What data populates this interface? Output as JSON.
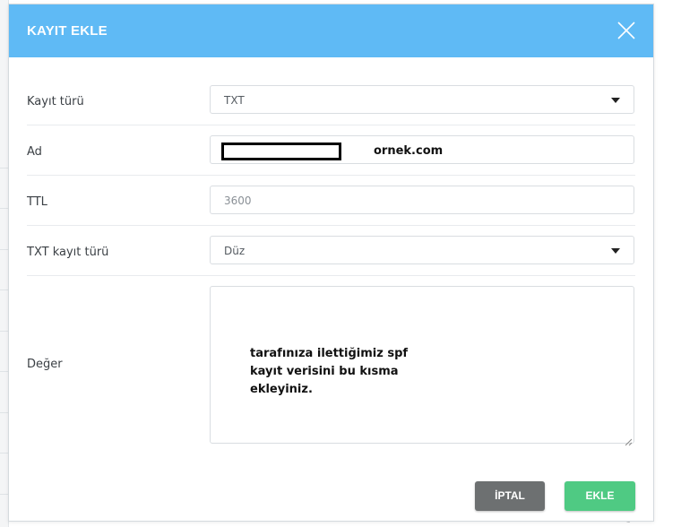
{
  "modal": {
    "title": "KAYIT EKLE",
    "close_icon": "close-icon"
  },
  "form": {
    "record_type": {
      "label": "Kayıt türü",
      "value": "TXT"
    },
    "name": {
      "label": "Ad",
      "annotation": "ornek.com"
    },
    "ttl": {
      "label": "TTL",
      "placeholder": "3600"
    },
    "txt_type": {
      "label": "TXT kayıt türü",
      "value": "Düz"
    },
    "value": {
      "label": "Değer",
      "annotation_lines": [
        "tarafınıza ilettiğimiz spf",
        "kayıt verisini bu kısma",
        "ekleyiniz."
      ]
    }
  },
  "buttons": {
    "cancel": "İPTAL",
    "add": "EKLE"
  },
  "colors": {
    "header": "#5fbaf5",
    "cancel": "#6d7071",
    "add": "#4fca83"
  }
}
